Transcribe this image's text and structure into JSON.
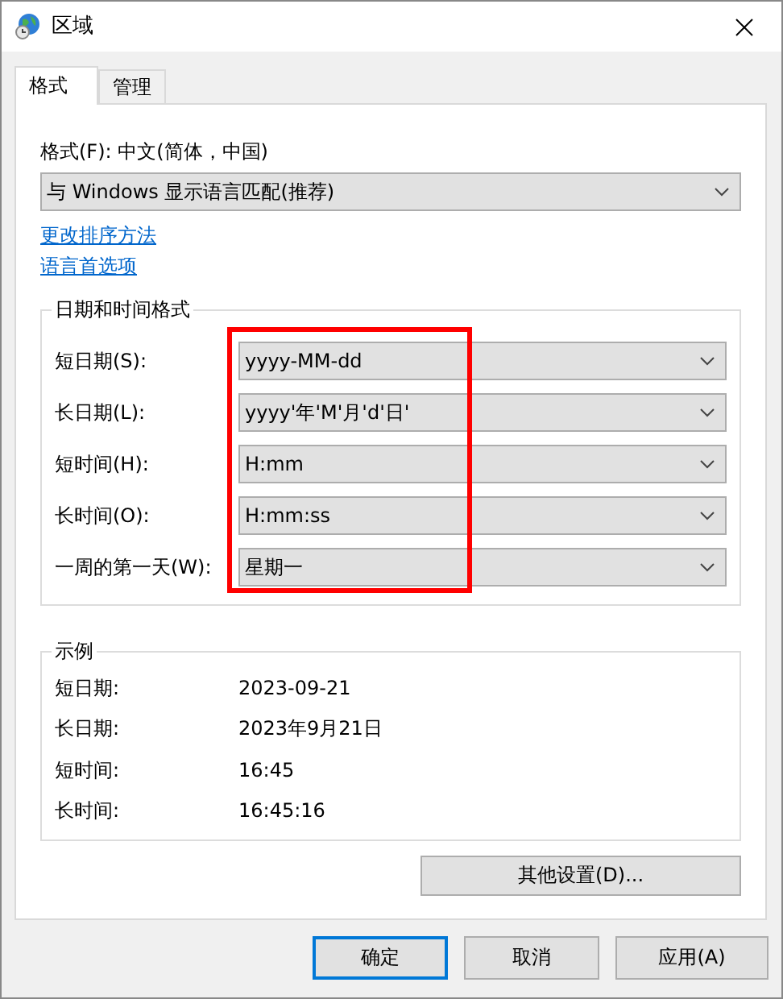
{
  "window": {
    "title": "区域"
  },
  "tabs": [
    {
      "label": "格式",
      "selected": true
    },
    {
      "label": "管理",
      "selected": false
    }
  ],
  "format": {
    "label": "格式(F): 中文(简体，中国)",
    "value": "与 Windows 显示语言匹配(推荐)"
  },
  "links": [
    "更改排序方法",
    "语言首选项"
  ],
  "date_time_formats": {
    "title": "日期和时间格式",
    "rows": [
      {
        "label": "短日期(S):",
        "value": "yyyy-MM-dd"
      },
      {
        "label": "长日期(L):",
        "value": "yyyy'年'M'月'd'日'"
      },
      {
        "label": "短时间(H):",
        "value": "H:mm"
      },
      {
        "label": "长时间(O):",
        "value": "H:mm:ss"
      },
      {
        "label": "一周的第一天(W):",
        "value": "星期一"
      }
    ]
  },
  "examples": {
    "title": "示例",
    "rows": [
      {
        "label": "短日期:",
        "value": "2023-09-21"
      },
      {
        "label": "长日期:",
        "value": "2023年9月21日"
      },
      {
        "label": "短时间:",
        "value": "16:45"
      },
      {
        "label": "长时间:",
        "value": "16:45:16"
      }
    ]
  },
  "additional_settings_button": "其他设置(D)...",
  "buttons": [
    {
      "label": "确定",
      "default": true
    },
    {
      "label": "取消",
      "default": false
    },
    {
      "label": "应用(A)",
      "default": false
    }
  ]
}
